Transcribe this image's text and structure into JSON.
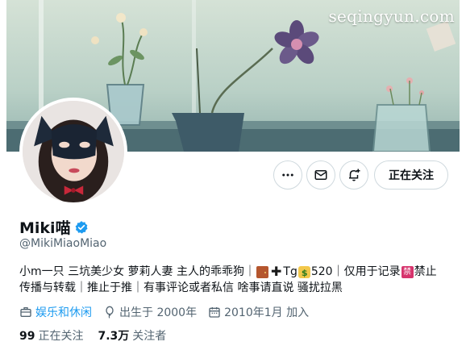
{
  "banner": {
    "watermark": "seqingyun.com"
  },
  "actions": {
    "more_icon": "more-horizontal-icon",
    "message_icon": "envelope-icon",
    "notify_icon": "bell-plus-icon",
    "follow_label": "正在关注"
  },
  "profile": {
    "display_name": "Miki喵",
    "verified_icon": "verified-badge-icon",
    "handle": "@MikiMiaoMiao"
  },
  "bio": {
    "line1_text": "小m一只 三坑美少女 萝莉人妻 主人的乖乖狗｜",
    "emoji_door": "door-emoji",
    "emoji_plus": "plus-emoji",
    "tg_text": "Tg",
    "emoji_money": "money-bag-emoji",
    "line1_tail": "520｜仅用于记录",
    "emoji_ban": "prohibited-emoji",
    "ban_glyph": "禁",
    "line1_end": "禁止",
    "line2_text": "传播与转载｜推止于推｜有事评论或者私信 啥事请直说 骚扰拉黑"
  },
  "meta": {
    "category": "娱乐和休闲",
    "birth": "出生于 2000年",
    "joined": "2010年1月 加入"
  },
  "stats": {
    "following_count": "99",
    "following_label": "正在关注",
    "followers_count": "7.3万",
    "followers_label": "关注者"
  },
  "colors": {
    "accent": "#1d9bf0",
    "text_primary": "#0f1419",
    "text_secondary": "#536471",
    "border": "#cfd9de"
  }
}
